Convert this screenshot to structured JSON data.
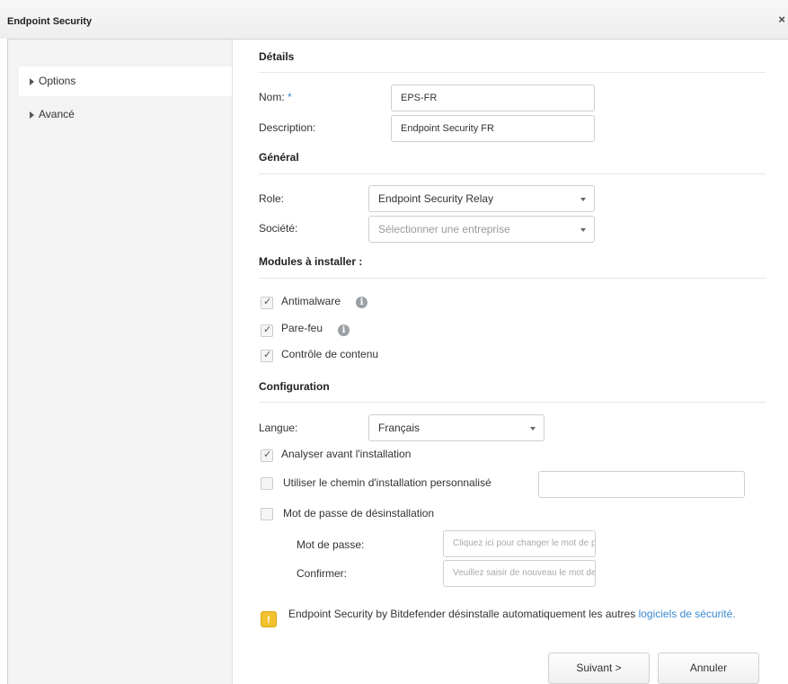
{
  "window": {
    "title": "Endpoint Security",
    "close_glyph": "×"
  },
  "sidebar": {
    "items": [
      {
        "label": "Options",
        "active": true
      },
      {
        "label": "Avancé",
        "active": false
      }
    ]
  },
  "details": {
    "title": "Détails",
    "name_label": "Nom:",
    "name_required": "*",
    "name_value": "EPS-FR",
    "description_label": "Description:",
    "description_value": "Endpoint Security FR"
  },
  "general": {
    "title": "Général",
    "role_label": "Role:",
    "role_value": "Endpoint Security Relay",
    "company_label": "Société:",
    "company_placeholder": "Sélectionner une entreprise"
  },
  "modules": {
    "title": "Modules à installer :",
    "items": [
      {
        "label": "Antimalware",
        "checked": true,
        "info": true
      },
      {
        "label": "Pare-feu",
        "checked": true,
        "info": true
      },
      {
        "label": "Contrôle de contenu",
        "checked": true,
        "info": false
      }
    ]
  },
  "configuration": {
    "title": "Configuration",
    "language_label": "Langue:",
    "language_value": "Français",
    "scan_label": "Analyser avant l'installation",
    "scan_checked": true,
    "custom_path_label": "Utiliser le chemin d'installation personnalisé",
    "custom_path_checked": false,
    "custom_path_value": "",
    "uninstall_password_label": "Mot de passe de désinstallation",
    "uninstall_password_checked": false,
    "password_label": "Mot de passe:",
    "password_placeholder": "Cliquez ici pour changer le mot de passe",
    "confirm_label": "Confirmer:",
    "confirm_placeholder": "Veuillez saisir de nouveau le mot de passe"
  },
  "notice": {
    "icon": "warning-icon",
    "glyph": "!",
    "text": "Endpoint Security by Bitdefender désinstalle automatiquement les autres ",
    "link": "logiciels de sécurité."
  },
  "buttons": {
    "next": "Suivant >",
    "cancel": "Annuler"
  },
  "colors": {
    "accent": "#3a8ad2",
    "warning": "#f2c12e",
    "sidebar_bg": "#f3f3f3",
    "info_icon": "#9aa0a6"
  }
}
